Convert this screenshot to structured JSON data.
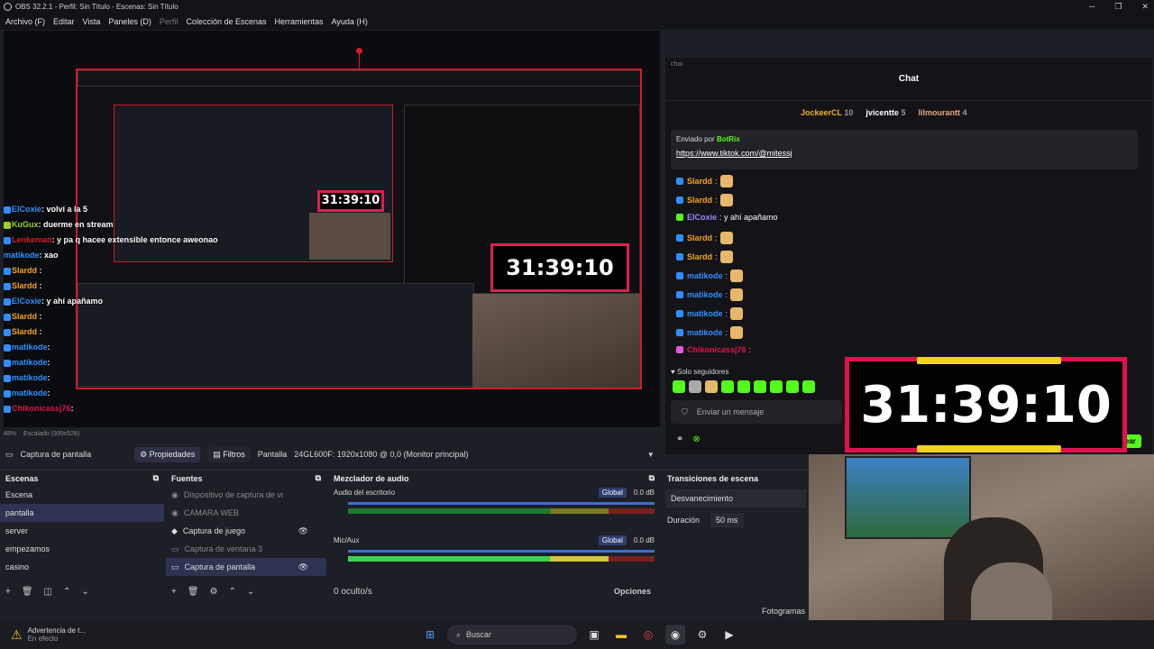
{
  "window": {
    "title": "OBS 32.2.1 - Perfil: Sin Título - Escenas: Sin Título"
  },
  "menu": [
    "Archivo (F)",
    "Editar",
    "Vista",
    "Paneles (D)",
    "Perfil",
    "Colección de Escenas",
    "Herramientas",
    "Ayuda (H)"
  ],
  "overlay_chat": [
    {
      "user": "ElCoxie",
      "text": ": volví a la 5"
    },
    {
      "user": "KuGux",
      "text": ": duerme en stream"
    },
    {
      "user": "Lenkeman",
      "text": ": y pa q hacee extensible entonce aweonao"
    },
    {
      "user": "matikode",
      "text": ": xao"
    },
    {
      "user": "Slardd",
      "text": " :"
    },
    {
      "user": "Slardd",
      "text": " :"
    },
    {
      "user": "ElCoxie",
      "text": ": y ahí apañamo"
    },
    {
      "user": "Slardd",
      "text": " :"
    },
    {
      "user": "Slardd",
      "text": " :"
    },
    {
      "user": "matikode",
      "text": ": "
    },
    {
      "user": "matikode",
      "text": ": "
    },
    {
      "user": "matikode",
      "text": ": "
    },
    {
      "user": "matikode",
      "text": ": "
    },
    {
      "user": "Chikonicassj76",
      "text": ": "
    }
  ],
  "timer": "31:39:10",
  "status": {
    "zoom": "48%",
    "scale": "Escalado (939x528)"
  },
  "source_bar": {
    "source": "Captura de pantalla",
    "props": "Propiedades",
    "filters": "Filtros",
    "display_label": "Pantalla",
    "display_value": "24GL600F: 1920x1080 @ 0,0 (Monitor principal)"
  },
  "scenes": {
    "title": "Escenas",
    "items": [
      "Escena",
      "pantalla",
      "server",
      "empezamos",
      "casino"
    ],
    "selected": 1
  },
  "sources": {
    "title": "Fuentes",
    "items": [
      "Dispositivo de captura de vi",
      "CAMARA WEB",
      "Captura de juego",
      "Captura de ventana 3",
      "Captura de pantalla"
    ]
  },
  "mixer": {
    "title": "Mezclador de audio",
    "desktop": "Audio del escritorio",
    "mic": "Mic/Aux",
    "global": "Global",
    "db": "0.0 dB",
    "hidden": "0 oculto/s",
    "options": "Opciones",
    "ticks": [
      "-60",
      "-54",
      "-48",
      "-42",
      "-36",
      "-30",
      "-24",
      "-18",
      "-12",
      "-6"
    ]
  },
  "transitions": {
    "title": "Transiciones de escena",
    "value": "Desvanecimiento",
    "duration_label": "Duración",
    "duration": "50 ms"
  },
  "fps_label": "Fotogramas",
  "chat": {
    "panel_label": "chat",
    "title": "Chat",
    "top": [
      {
        "name": "JockeerCL",
        "n": "10"
      },
      {
        "name": "jvicentte",
        "n": "5"
      },
      {
        "name": "lilmourantt",
        "n": "4"
      }
    ],
    "pinned_from": "Enviado por",
    "pinned_user": "BotRix",
    "pinned_link": "https://www.tiktok.com/@mitessj",
    "messages": [
      {
        "user": "Slardd",
        "text": ":"
      },
      {
        "user": "Slardd",
        "text": ":"
      },
      {
        "user": "ElCoxie",
        "text": ": y ahí apañamo"
      },
      {
        "user": "Slardd",
        "text": ":"
      },
      {
        "user": "Slardd",
        "text": ":"
      },
      {
        "user": "matikode",
        "text": ":"
      },
      {
        "user": "matikode",
        "text": ":"
      },
      {
        "user": "matikode",
        "text": ":"
      },
      {
        "user": "matikode",
        "text": ":"
      },
      {
        "user": "Chikonicassj76",
        "text": ":"
      }
    ],
    "followers_only": "Solo seguidores",
    "placeholder": "Enviar un mensaje",
    "send": "Chatear"
  },
  "warning": {
    "title": "Advertencia de t...",
    "sub": "En efecto"
  },
  "taskbar": {
    "search": "Buscar"
  },
  "colors": {
    "accent": "#e0114d",
    "timer_tab": "#f1d21e",
    "kick_green": "#53fc18"
  }
}
